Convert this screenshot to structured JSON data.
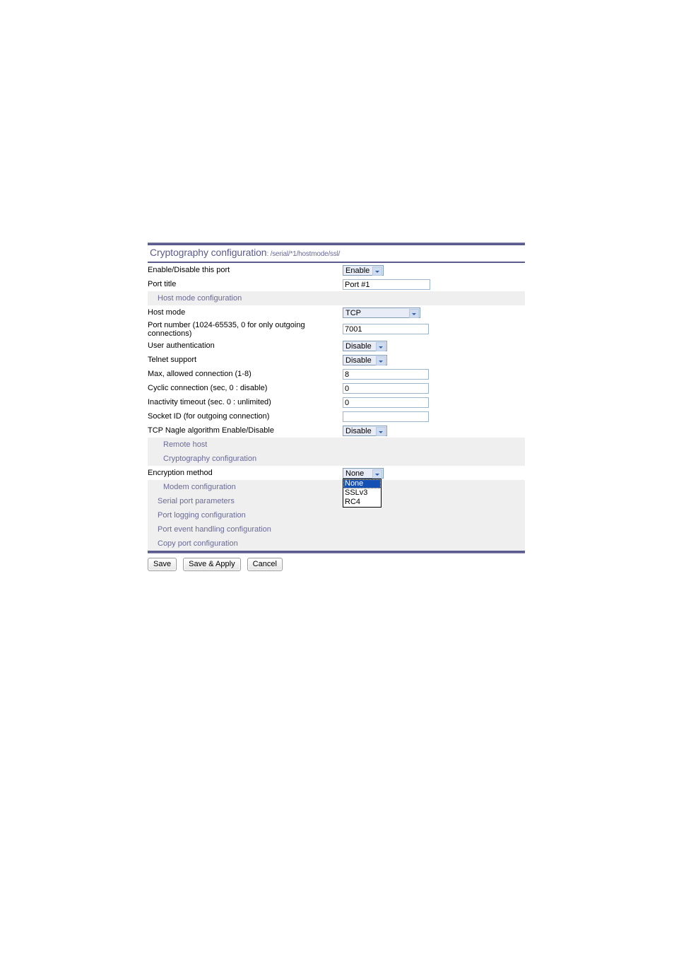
{
  "page": {
    "title_main": "Cryptography configuration",
    "title_path": ": /serial/*1/hostmode/ssl/"
  },
  "rows": {
    "enable_port": {
      "label": "Enable/Disable this port",
      "value": "Enable"
    },
    "port_title": {
      "label": "Port title",
      "value": "Port #1"
    },
    "host_mode_section": {
      "label": "Host mode configuration"
    },
    "host_mode": {
      "label": "Host mode",
      "value": "TCP"
    },
    "port_number": {
      "label": "Port number (1024-65535, 0 for only outgoing connections)",
      "value": "7001"
    },
    "user_auth": {
      "label": "User authentication",
      "value": "Disable"
    },
    "telnet_support": {
      "label": "Telnet support",
      "value": "Disable"
    },
    "max_connection": {
      "label": "Max, allowed connection (1-8)",
      "value": "8"
    },
    "cyclic_connection": {
      "label": "Cyclic connection (sec, 0 : disable)",
      "value": "0"
    },
    "inactivity_timeout": {
      "label": "Inactivity timeout (sec. 0 : unlimited)",
      "value": "0"
    },
    "socket_id": {
      "label": "Socket ID (for outgoing connection)",
      "value": ""
    },
    "tcp_nagle": {
      "label": "TCP Nagle algorithm Enable/Disable",
      "value": "Disable"
    },
    "remote_host_section": {
      "label": "Remote host"
    },
    "crypto_section": {
      "label": "Cryptography configuration"
    },
    "encryption_method": {
      "label": "Encryption method",
      "value": "None"
    },
    "modem_section": {
      "label": "Modem configuration"
    },
    "serial_params_section": {
      "label": "Serial port parameters"
    },
    "port_logging_section": {
      "label": "Port logging configuration"
    },
    "port_event_section": {
      "label": "Port event handling configuration"
    },
    "copy_port_section": {
      "label": "Copy port configuration"
    }
  },
  "encryption_options": [
    {
      "label": "None",
      "selected": true
    },
    {
      "label": "SSLv3",
      "selected": false
    },
    {
      "label": "RC4",
      "selected": false
    }
  ],
  "buttons": {
    "save": "Save",
    "save_apply": "Save & Apply",
    "cancel": "Cancel"
  },
  "colors": {
    "accent": "#5b5b8f",
    "section_bg": "#efefef",
    "select_bg": "#e8ecf6",
    "highlight": "#1450b4"
  }
}
